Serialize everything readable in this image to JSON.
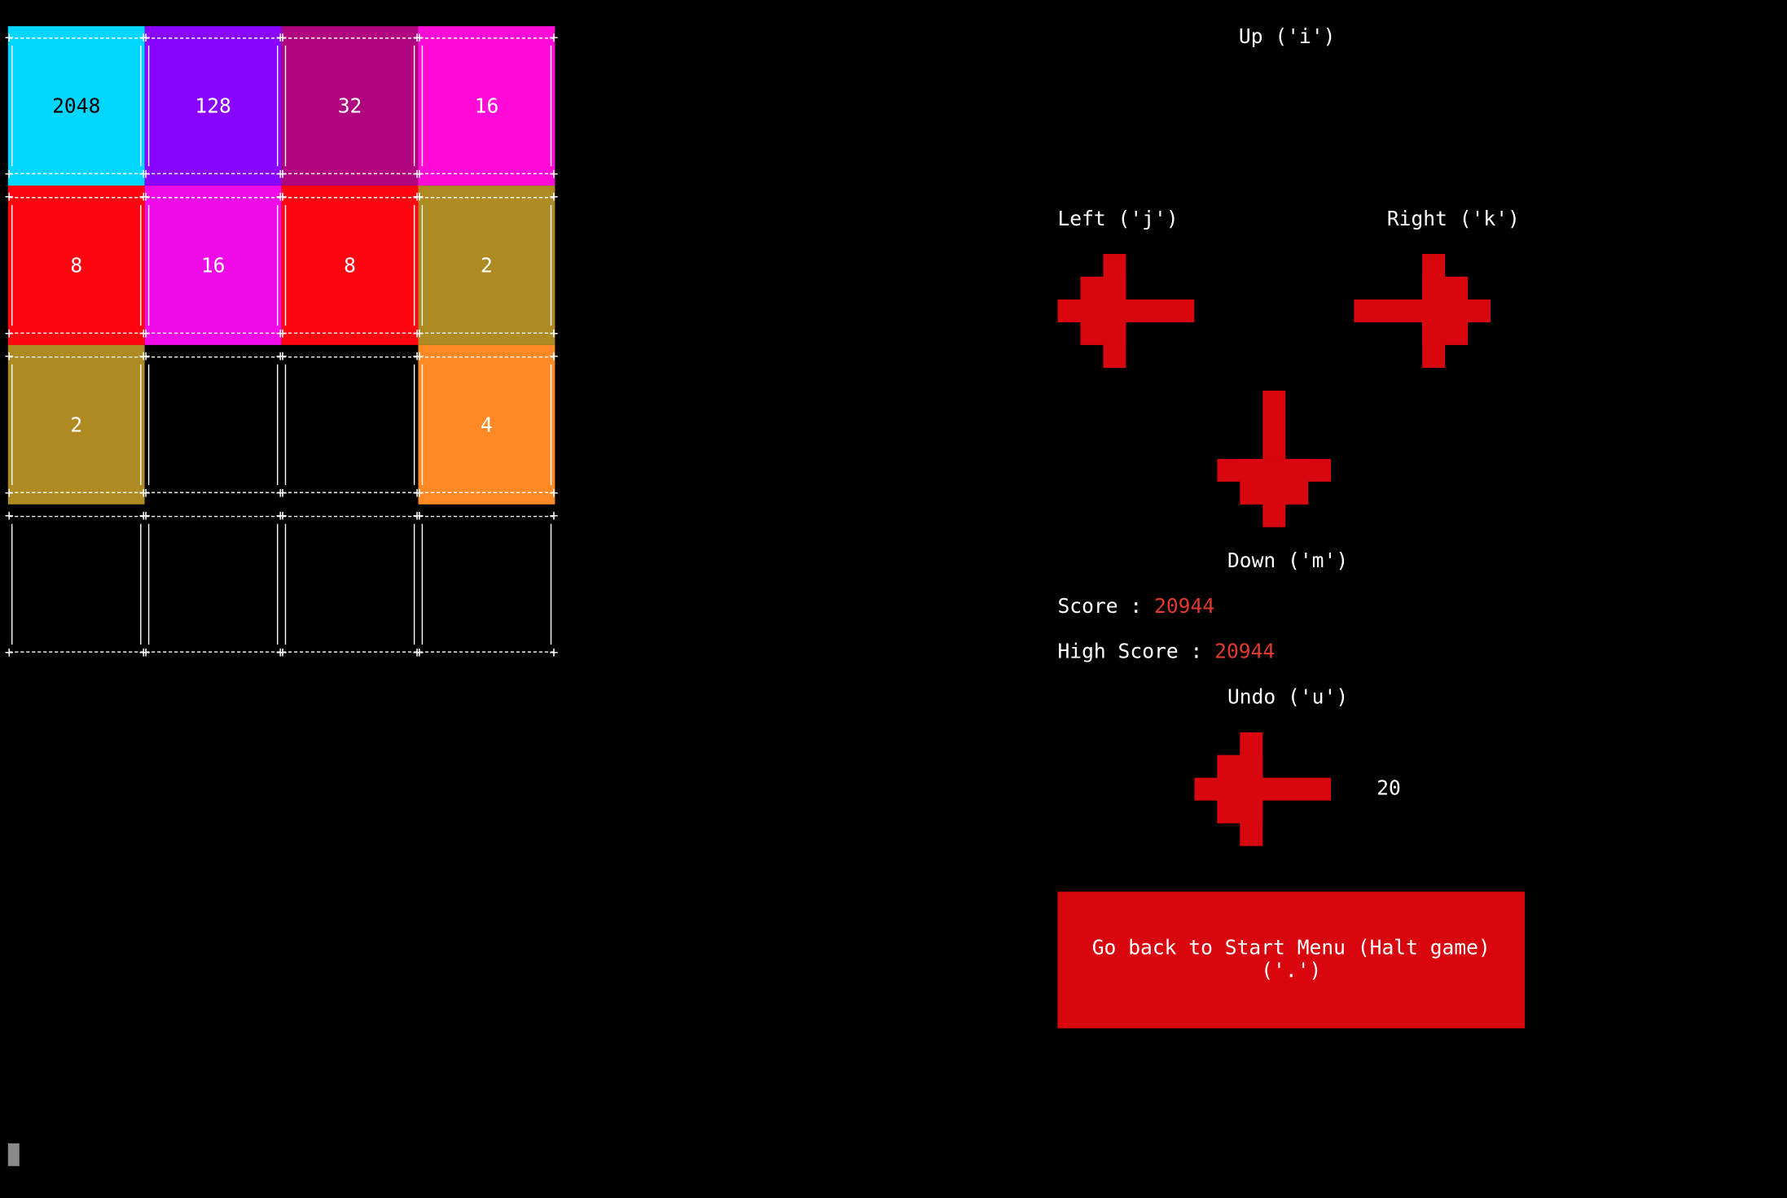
{
  "board": {
    "rows": [
      [
        {
          "value": "2048",
          "color": "#00d6ff",
          "dark_text": true
        },
        {
          "value": "128",
          "color": "#8a05ff"
        },
        {
          "value": "32",
          "color": "#b1047f"
        },
        {
          "value": "16",
          "color": "#ff0ad6"
        }
      ],
      [
        {
          "value": "8",
          "color": "#ff0510"
        },
        {
          "value": "16",
          "color": "#ef0ae8"
        },
        {
          "value": "8",
          "color": "#ff0510"
        },
        {
          "value": "2",
          "color": "#ae8a22"
        }
      ],
      [
        {
          "value": "2",
          "color": "#ae8a22"
        },
        {
          "value": "",
          "color": "#000000"
        },
        {
          "value": "",
          "color": "#000000"
        },
        {
          "value": "4",
          "color": "#ff8a25"
        }
      ],
      [
        {
          "value": "",
          "color": "#000000"
        },
        {
          "value": "",
          "color": "#000000"
        },
        {
          "value": "",
          "color": "#000000"
        },
        {
          "value": "",
          "color": "#000000"
        }
      ]
    ]
  },
  "controls": {
    "up_label": "Up ('i')",
    "left_label": "Left ('j')",
    "right_label": "Right ('k')",
    "down_label": "Down ('m')",
    "undo_label": "Undo ('u')",
    "arrow_color": "#d8060e"
  },
  "score": {
    "score_label": "Score : ",
    "score_value": "20944",
    "high_score_label": "High Score : ",
    "high_score_value": "20944"
  },
  "undo": {
    "remaining": "20"
  },
  "halt_button": {
    "line1": "Go back to Start Menu (Halt game)",
    "line2": "('.')"
  }
}
